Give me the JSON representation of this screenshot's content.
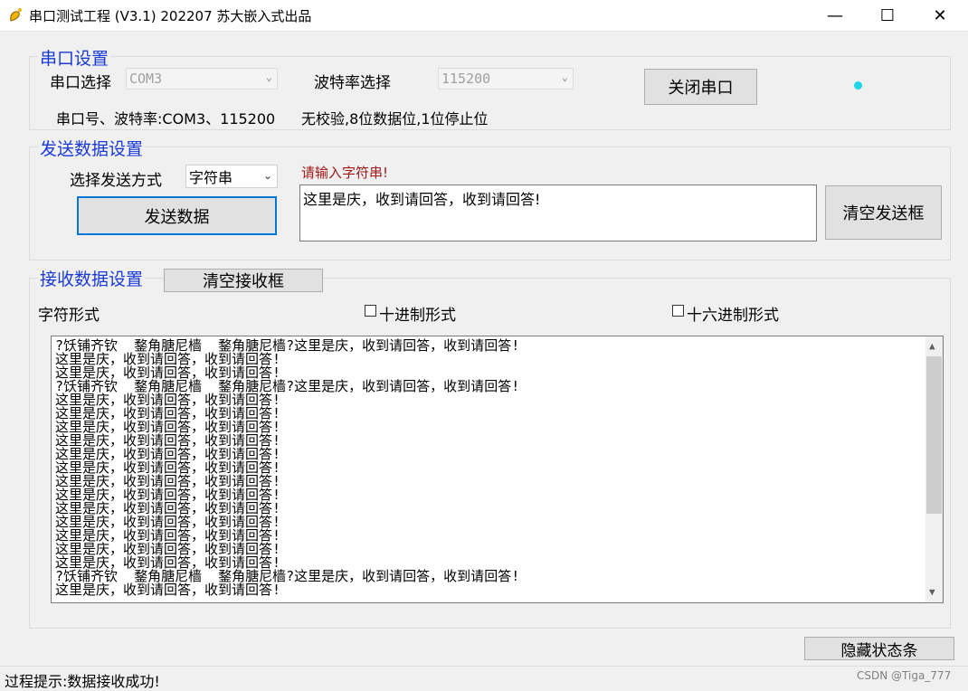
{
  "window": {
    "title": "串口测试工程 (V3.1) 202207   苏大嵌入式出品",
    "minimize_glyph": "—",
    "maximize_glyph": "☐",
    "close_glyph": "✕"
  },
  "serial_settings": {
    "group_title": "串口设置",
    "port_label": "串口选择",
    "port_value": "COM3",
    "baud_label": "波特率选择",
    "baud_value": "115200",
    "close_button": "关闭串口",
    "info_line": "串口号、波特率:COM3、115200",
    "format_line": "无校验,8位数据位,1位停止位",
    "led_color": "#1ed6e8"
  },
  "send_settings": {
    "group_title": "发送数据设置",
    "mode_label": "选择发送方式",
    "mode_value": "字符串",
    "send_button": "发送数据",
    "prompt": "请输入字符串!",
    "input_value": "这里是庆，收到请回答，收到请回答!",
    "clear_button": "清空发送框"
  },
  "receive_settings": {
    "group_title": "接收数据设置",
    "clear_button": "清空接收框",
    "char_format_label": "字符形式",
    "decimal_label": "十进制形式",
    "hex_label": "十六进制形式",
    "lines": [
      "?饫铺齐钦  鍪角膅尼樯  鍪角膅尼樯?这里是庆，收到请回答，收到请回答!",
      "这里是庆，收到请回答，收到请回答!",
      "这里是庆，收到请回答，收到请回答!",
      "?饫铺齐钦  鍪角膅尼樯  鍪角膅尼樯?这里是庆，收到请回答，收到请回答!",
      "这里是庆，收到请回答，收到请回答!",
      "这里是庆，收到请回答，收到请回答!",
      "这里是庆，收到请回答，收到请回答!",
      "这里是庆，收到请回答，收到请回答!",
      "这里是庆，收到请回答，收到请回答!",
      "这里是庆，收到请回答，收到请回答!",
      "这里是庆，收到请回答，收到请回答!",
      "这里是庆，收到请回答，收到请回答!",
      "这里是庆，收到请回答，收到请回答!",
      "这里是庆，收到请回答，收到请回答!",
      "这里是庆，收到请回答，收到请回答!",
      "这里是庆，收到请回答，收到请回答!",
      "这里是庆，收到请回答，收到请回答!",
      "?饫铺齐钦  鍪角膅尼樯  鍪角膅尼樯?这里是庆，收到请回答，收到请回答!",
      "这里是庆，收到请回答，收到请回答!"
    ]
  },
  "footer": {
    "hide_status_button": "隐藏状态条",
    "status_text": "过程提示:数据接收成功!",
    "watermark": "CSDN @Tiga_777"
  }
}
